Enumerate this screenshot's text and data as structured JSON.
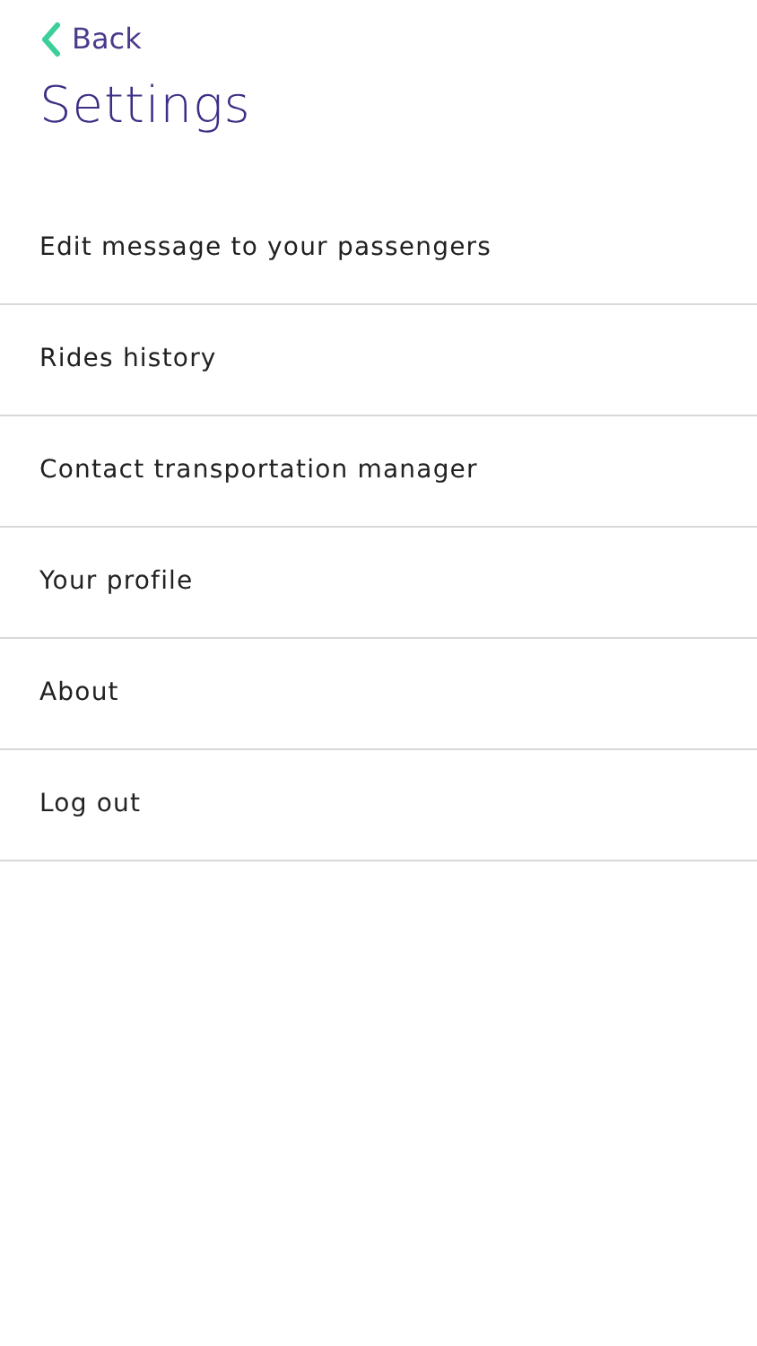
{
  "back": {
    "label": "Back"
  },
  "title": "Settings",
  "items": [
    {
      "label": "Edit message to your passengers"
    },
    {
      "label": "Rides history"
    },
    {
      "label": "Contact transportation manager"
    },
    {
      "label": "Your profile"
    },
    {
      "label": "About"
    },
    {
      "label": "Log out"
    }
  ]
}
